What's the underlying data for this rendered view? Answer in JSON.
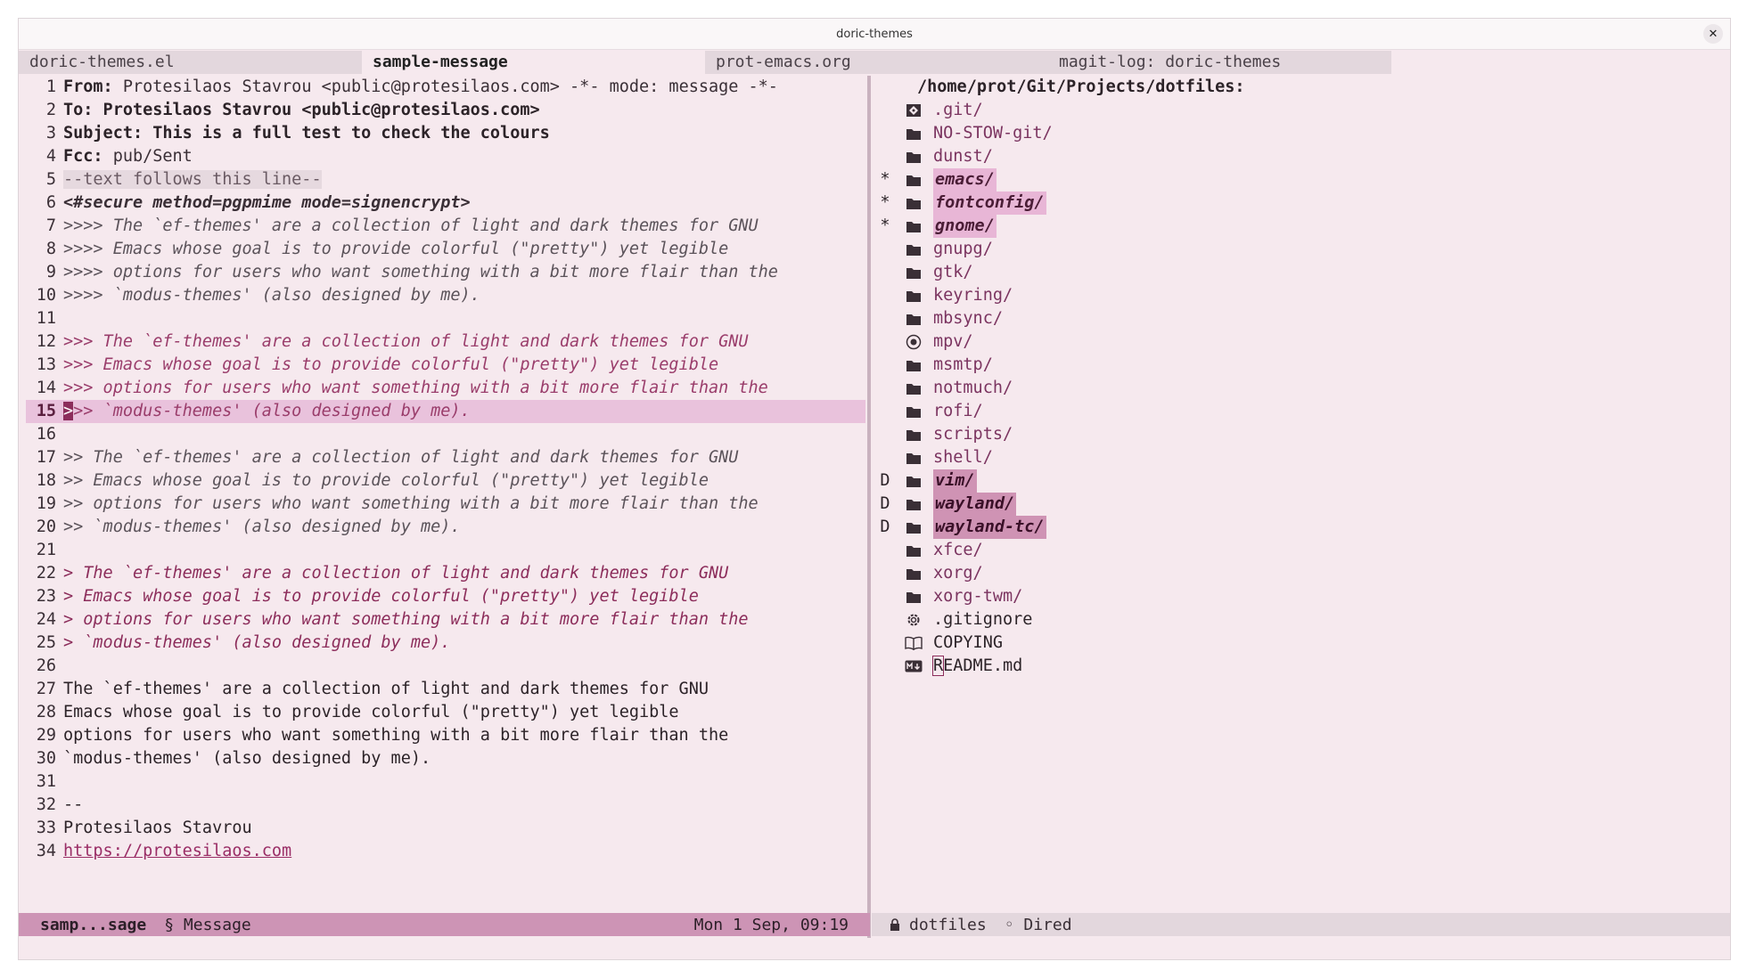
{
  "window": {
    "title": "doric-themes"
  },
  "tabs": [
    {
      "label": "doric-themes.el",
      "active": false
    },
    {
      "label": "sample-message",
      "active": true
    },
    {
      "label": "prot-emacs.org",
      "active": false
    },
    {
      "label": "magit-log: doric-themes",
      "active": false
    }
  ],
  "message": {
    "lines": [
      {
        "n": "1",
        "key": "From:",
        "val": " Protesilaos Stavrou <public@protesilaos.com> -*- mode: message -*-"
      },
      {
        "n": "2",
        "key": "To:",
        "val": " Protesilaos Stavrou <public@protesilaos.com>"
      },
      {
        "n": "3",
        "key": "Subject:",
        "val": " This is a full test to check the colours"
      },
      {
        "n": "4",
        "key": "Fcc:",
        "val": " pub/Sent"
      },
      {
        "n": "5",
        "text": "--text follows this line--"
      },
      {
        "n": "6",
        "text": "<#secure method=pgpmime mode=signencrypt>"
      },
      {
        "n": "7",
        "text": ">>>> The `ef-themes' are a collection of light and dark themes for GNU"
      },
      {
        "n": "8",
        "text": ">>>> Emacs whose goal is to provide colorful (\"pretty\") yet legible"
      },
      {
        "n": "9",
        "text": ">>>> options for users who want something with a bit more flair than the"
      },
      {
        "n": "10",
        "text": ">>>> `modus-themes' (also designed by me)."
      },
      {
        "n": "11",
        "text": ""
      },
      {
        "n": "12",
        "text": ">>> The `ef-themes' are a collection of light and dark themes for GNU"
      },
      {
        "n": "13",
        "text": ">>> Emacs whose goal is to provide colorful (\"pretty\") yet legible"
      },
      {
        "n": "14",
        "text": ">>> options for users who want something with a bit more flair than the"
      },
      {
        "n": "15",
        "cursor_char": ">",
        "text": ">> `modus-themes' (also designed by me)."
      },
      {
        "n": "16",
        "text": ""
      },
      {
        "n": "17",
        "text": ">> The `ef-themes' are a collection of light and dark themes for GNU"
      },
      {
        "n": "18",
        "text": ">> Emacs whose goal is to provide colorful (\"pretty\") yet legible"
      },
      {
        "n": "19",
        "text": ">> options for users who want something with a bit more flair than the"
      },
      {
        "n": "20",
        "text": ">> `modus-themes' (also designed by me)."
      },
      {
        "n": "21",
        "text": ""
      },
      {
        "n": "22",
        "text": "> The `ef-themes' are a collection of light and dark themes for GNU"
      },
      {
        "n": "23",
        "text": "> Emacs whose goal is to provide colorful (\"pretty\") yet legible"
      },
      {
        "n": "24",
        "text": "> options for users who want something with a bit more flair than the"
      },
      {
        "n": "25",
        "text": "> `modus-themes' (also designed by me)."
      },
      {
        "n": "26",
        "text": ""
      },
      {
        "n": "27",
        "text": "The `ef-themes' are a collection of light and dark themes for GNU"
      },
      {
        "n": "28",
        "text": "Emacs whose goal is to provide colorful (\"pretty\") yet legible"
      },
      {
        "n": "29",
        "text": "options for users who want something with a bit more flair than the"
      },
      {
        "n": "30",
        "text": "`modus-themes' (also designed by me)."
      },
      {
        "n": "31",
        "text": ""
      },
      {
        "n": "32",
        "text": "--"
      },
      {
        "n": "33",
        "text": "Protesilaos Stavrou"
      },
      {
        "n": "34",
        "text": "https://protesilaos.com"
      }
    ]
  },
  "dired": {
    "header": "/home/prot/Git/Projects/dotfiles:",
    "entries": [
      {
        "mark": "",
        "icon": "git-icon",
        "name": ".git/",
        "state": "normal"
      },
      {
        "mark": "",
        "icon": "folder-icon",
        "name": "NO-STOW-git/",
        "state": "normal"
      },
      {
        "mark": "",
        "icon": "folder-icon",
        "name": "dunst/",
        "state": "normal"
      },
      {
        "mark": "*",
        "icon": "folder-icon",
        "name": "emacs/",
        "state": "marked"
      },
      {
        "mark": "*",
        "icon": "folder-icon",
        "name": "fontconfig/",
        "state": "marked"
      },
      {
        "mark": "*",
        "icon": "folder-icon",
        "name": "gnome/",
        "state": "marked"
      },
      {
        "mark": "",
        "icon": "folder-icon",
        "name": "gnupg/",
        "state": "normal"
      },
      {
        "mark": "",
        "icon": "folder-icon",
        "name": "gtk/",
        "state": "normal"
      },
      {
        "mark": "",
        "icon": "folder-icon",
        "name": "keyring/",
        "state": "normal"
      },
      {
        "mark": "",
        "icon": "folder-icon",
        "name": "mbsync/",
        "state": "normal"
      },
      {
        "mark": "",
        "icon": "disc-icon",
        "name": "mpv/",
        "state": "normal"
      },
      {
        "mark": "",
        "icon": "folder-icon",
        "name": "msmtp/",
        "state": "normal"
      },
      {
        "mark": "",
        "icon": "folder-icon",
        "name": "notmuch/",
        "state": "normal"
      },
      {
        "mark": "",
        "icon": "folder-icon",
        "name": "rofi/",
        "state": "normal"
      },
      {
        "mark": "",
        "icon": "folder-icon",
        "name": "scripts/",
        "state": "normal"
      },
      {
        "mark": "",
        "icon": "folder-icon",
        "name": "shell/",
        "state": "normal"
      },
      {
        "mark": "D",
        "icon": "folder-icon",
        "name": "vim/",
        "state": "deleted"
      },
      {
        "mark": "D",
        "icon": "folder-icon",
        "name": "wayland/",
        "state": "deleted"
      },
      {
        "mark": "D",
        "icon": "folder-icon",
        "name": "wayland-tc/",
        "state": "deleted"
      },
      {
        "mark": "",
        "icon": "folder-icon",
        "name": "xfce/",
        "state": "normal"
      },
      {
        "mark": "",
        "icon": "folder-icon",
        "name": "xorg/",
        "state": "normal"
      },
      {
        "mark": "",
        "icon": "folder-icon",
        "name": "xorg-twm/",
        "state": "normal"
      },
      {
        "mark": "",
        "icon": "gear-icon",
        "name": ".gitignore",
        "state": "file"
      },
      {
        "mark": "",
        "icon": "book-icon",
        "name": "COPYING",
        "state": "file"
      },
      {
        "mark": "",
        "icon": "markdown-icon",
        "name": "README.md",
        "state": "file",
        "cursor_char": "R"
      }
    ]
  },
  "modeline": {
    "left_buffer": "samp...sage",
    "left_mode": "§ Message",
    "left_time": "Mon  1 Sep, 09:19",
    "right_buffer": "dotfiles",
    "right_mode": "◦ Dired"
  },
  "colors": {
    "background": "#f6e9ee",
    "modeline_active": "#cd94b5",
    "highlight_line": "#e9c2dc",
    "accent": "#8c2d5b"
  }
}
